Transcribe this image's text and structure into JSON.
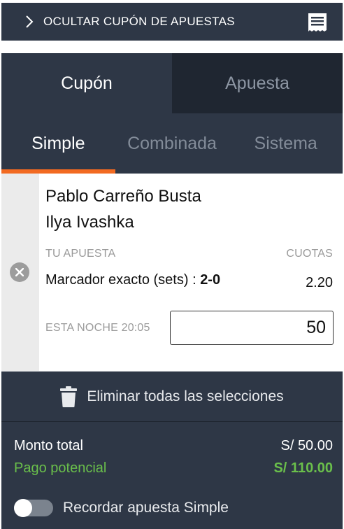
{
  "topbar": {
    "label": "OCULTAR CUPÓN DE APUESTAS",
    "toggle_icon": "chevron-right-icon",
    "bet_slip_icon": "receipt-icon"
  },
  "tabs_main": [
    {
      "label": "Cupón",
      "active": true
    },
    {
      "label": "Apuesta",
      "active": false
    }
  ],
  "tabs_sub": [
    {
      "label": "Simple",
      "active": true
    },
    {
      "label": "Combinada",
      "active": false
    },
    {
      "label": "Sistema",
      "active": false
    }
  ],
  "bet": {
    "player1": "Pablo Carreño Busta",
    "player2": "Ilya Ivashka",
    "your_bet_label": "TU APUESTA",
    "odds_label": "CUOTAS",
    "market": "Marcador exacto (sets) : ",
    "selection": "2-0",
    "odds": "2.20",
    "time": "ESTA NOCHE 20:05",
    "stake": "50",
    "remove_icon": "close-circle-icon"
  },
  "remove_all": {
    "label": "Eliminar todas las selecciones",
    "icon": "trash-icon"
  },
  "totals": {
    "total_label": "Monto total",
    "total_value": "S/ 50.00",
    "potential_label": "Pago potencial",
    "potential_value": "S/ 110.00"
  },
  "remember": {
    "label": "Recordar apuesta Simple",
    "enabled": false
  },
  "colors": {
    "panel": "#2e3746",
    "accent": "#f26a21",
    "positive": "#6abf4b"
  }
}
